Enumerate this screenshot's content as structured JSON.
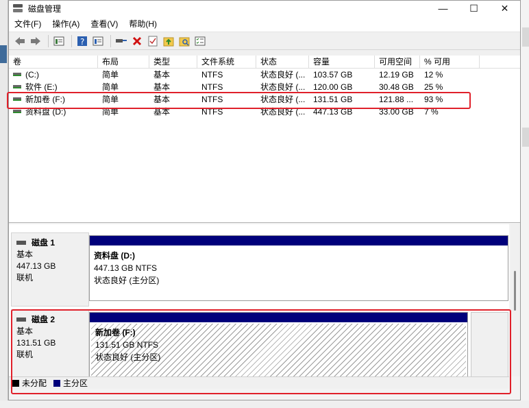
{
  "window": {
    "title": "磁盘管理",
    "minimize": "—",
    "maximize": "☐",
    "close": "✕"
  },
  "menu": [
    {
      "label": "文件(F)"
    },
    {
      "label": "操作(A)"
    },
    {
      "label": "查看(V)"
    },
    {
      "label": "帮助(H)"
    }
  ],
  "toolbar": {
    "icons": [
      "back-icon",
      "forward-icon",
      "list-view-icon",
      "help-icon",
      "properties-icon",
      "connect-icon",
      "delete-icon",
      "check-icon",
      "folder-up-icon",
      "search-folder-icon",
      "checklist-icon"
    ]
  },
  "volumes": {
    "columns": [
      "卷",
      "布局",
      "类型",
      "文件系统",
      "状态",
      "容量",
      "可用空间",
      "% 可用"
    ],
    "rows": [
      [
        "(C:)",
        "简单",
        "基本",
        "NTFS",
        "状态良好 (...",
        "103.57 GB",
        "12.19 GB",
        "12 %"
      ],
      [
        "软件 (E:)",
        "简单",
        "基本",
        "NTFS",
        "状态良好 (...",
        "120.00 GB",
        "30.48 GB",
        "25 %"
      ],
      [
        "新加卷 (F:)",
        "简单",
        "基本",
        "NTFS",
        "状态良好 (...",
        "131.51 GB",
        "121.88 ...",
        "93 %"
      ],
      [
        "资料盘 (D:)",
        "简单",
        "基本",
        "NTFS",
        "状态良好 (...",
        "447.13 GB",
        "33.00 GB",
        "7 %"
      ]
    ]
  },
  "disks": [
    {
      "name": "磁盘 1",
      "type": "基本",
      "size": "447.13 GB",
      "status": "联机",
      "partition": {
        "name": "资料盘  (D:)",
        "size": "447.13 GB NTFS",
        "status": "状态良好 (主分区)"
      }
    },
    {
      "name": "磁盘 2",
      "type": "基本",
      "size": "131.51 GB",
      "status": "联机",
      "partition": {
        "name": "新加卷  (F:)",
        "size": "131.51 GB NTFS",
        "status": "状态良好 (主分区)"
      }
    }
  ],
  "legend": {
    "unallocated": "未分配",
    "primary": "主分区"
  },
  "colors": {
    "primary_partition": "#00007b",
    "unallocated": "#000000",
    "highlight": "#e0202a"
  }
}
